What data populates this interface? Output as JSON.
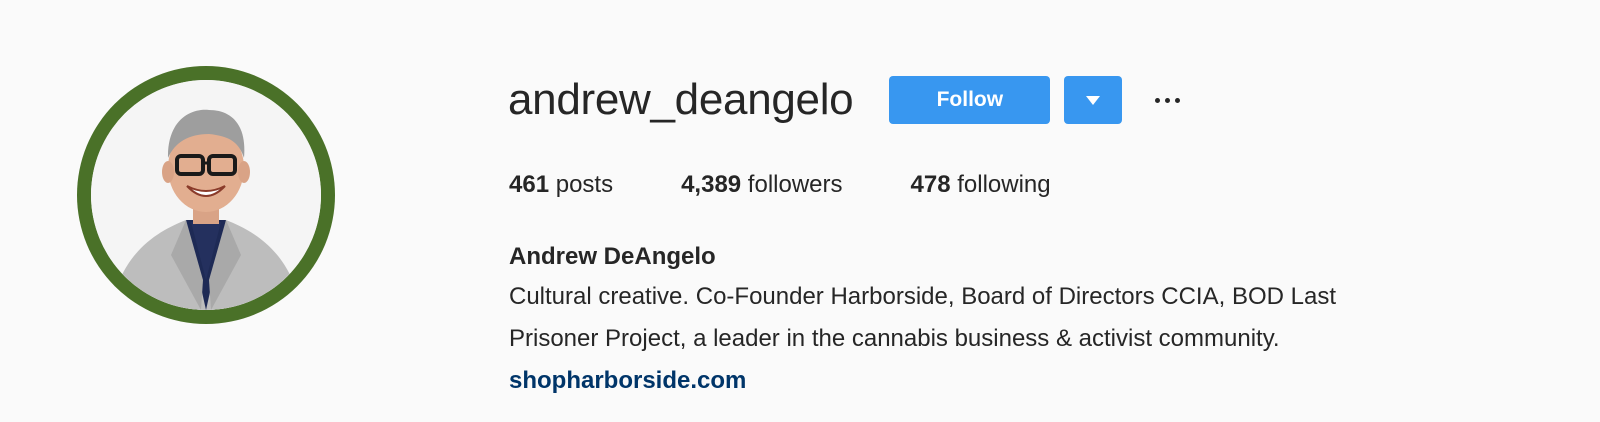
{
  "profile": {
    "username": "andrew_deangelo",
    "follow_label": "Follow",
    "full_name": "Andrew DeAngelo",
    "bio_line_1": "Cultural creative. Co-Founder Harborside, Board of Directors CCIA, BOD Last",
    "bio_line_2": "Prisoner Project, a leader in the cannabis business & activist community.",
    "website": "shopharborside.com"
  },
  "stats": {
    "posts_count": "461",
    "posts_label": " posts",
    "followers_count": "4,389",
    "followers_label": " followers",
    "following_count": "478",
    "following_label": " following"
  },
  "colors": {
    "accent": "#3897f0",
    "avatar_ring": "#4a7128",
    "link": "#003569",
    "background": "#fafafa"
  },
  "icons": {
    "dropdown": "triangle-down-icon",
    "more": "more-options-icon"
  }
}
